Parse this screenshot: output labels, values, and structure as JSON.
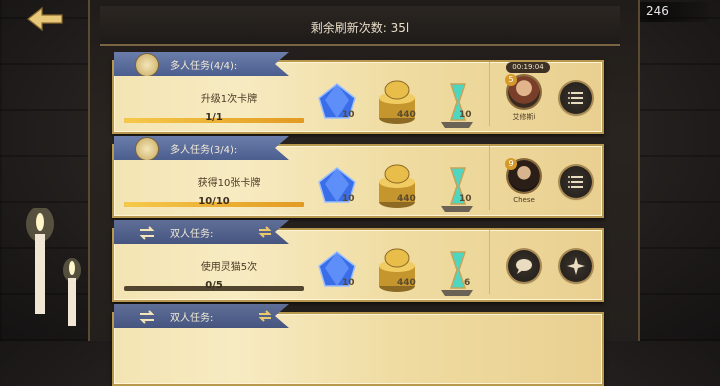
{
  "header": {
    "refresh_label": "剩余刷新次数: 35l"
  },
  "currency": {
    "gems": "246",
    "icon": "blue-gem-icon"
  },
  "cards": [
    {
      "ribbon": "多人任务(4/4):",
      "type": "multi",
      "task": "升级1次卡牌",
      "progress": "1/1",
      "fill": 1.0,
      "rewards": [
        {
          "icon": "crystal-icon",
          "count": "10"
        },
        {
          "icon": "gold-coin-stack-icon",
          "count": "440"
        },
        {
          "icon": "hourglass-icon",
          "count": "10"
        }
      ],
      "player": {
        "timer": "00:19:04",
        "name": "艾修斯i",
        "level": "5"
      }
    },
    {
      "ribbon": "多人任务(3/4):",
      "type": "multi",
      "task": "获得10张卡牌",
      "progress": "10/10",
      "fill": 1.0,
      "rewards": [
        {
          "icon": "crystal-icon",
          "count": "10"
        },
        {
          "icon": "gold-coin-stack-icon",
          "count": "440"
        },
        {
          "icon": "hourglass-icon",
          "count": "10"
        }
      ],
      "player": {
        "timer": "",
        "name": "Chese",
        "level": "9"
      }
    },
    {
      "ribbon": "双人任务:",
      "type": "duo",
      "task": "使用灵猫5次",
      "progress": "0/5",
      "fill": 0,
      "rewards": [
        {
          "icon": "crystal-icon",
          "count": "10"
        },
        {
          "icon": "gold-coin-stack-icon",
          "count": "440"
        },
        {
          "icon": "hourglass-icon",
          "count": "6"
        }
      ],
      "player": null
    },
    {
      "ribbon": "双人任务:",
      "type": "duo",
      "task": "",
      "progress": "",
      "fill": 0,
      "rewards": [],
      "player": null
    }
  ],
  "colors": {
    "ribbon_blue": "#5a6c9c",
    "progress_fill": "#f0b036",
    "card_parchment": "#f3e4b2"
  }
}
